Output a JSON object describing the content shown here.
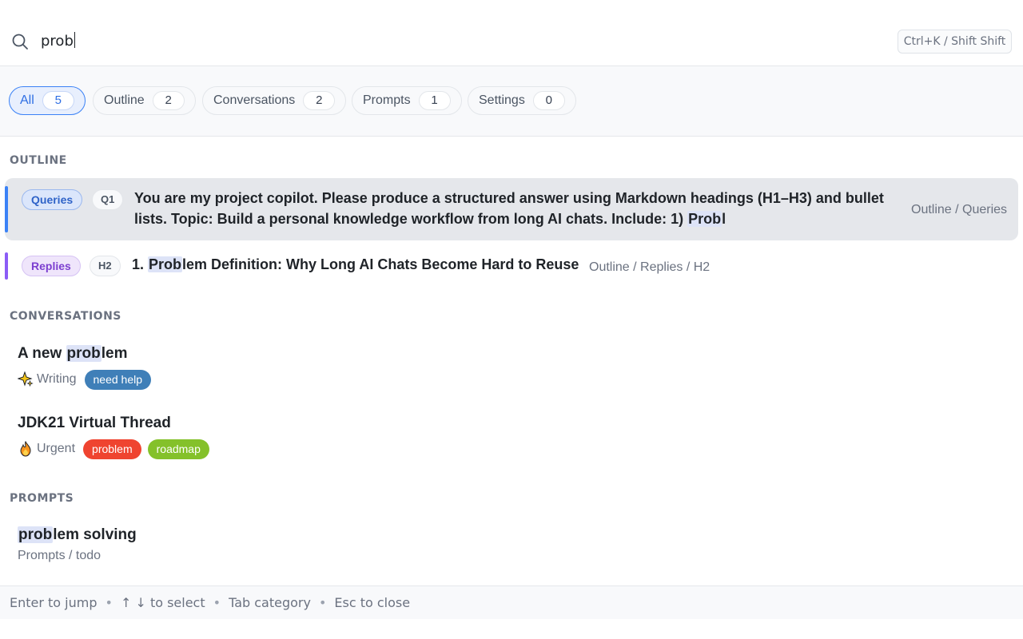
{
  "search": {
    "query": "prob",
    "shortcut": "Ctrl+K / Shift Shift"
  },
  "tabs": [
    {
      "label": "All",
      "count": "5",
      "active": true
    },
    {
      "label": "Outline",
      "count": "2"
    },
    {
      "label": "Conversations",
      "count": "2"
    },
    {
      "label": "Prompts",
      "count": "1"
    },
    {
      "label": "Settings",
      "count": "0"
    }
  ],
  "sections": {
    "outline": "OUTLINE",
    "conversations": "CONVERSATIONS",
    "prompts": "PROMPTS"
  },
  "outline_items": [
    {
      "role": "Queries",
      "level": "Q1",
      "title_before": "You are my project copilot. Please produce a structured answer using Markdown headings (H1–H3) and bullet lists. Topic: Build a personal knowledge workflow from long AI chats. Include: 1) ",
      "title_match": "Prob",
      "title_after": "l",
      "path": "Outline / Queries",
      "selected": true,
      "accent": "#3b82f6"
    },
    {
      "role": "Replies",
      "level": "H2",
      "title_before": "1. ",
      "title_match": "Prob",
      "title_after": "lem Definition: Why Long AI Chats Become Hard to Reuse",
      "path": "Outline / Replies / H2",
      "selected": false,
      "accent": "#8b5cf6"
    }
  ],
  "conversations": [
    {
      "title_before": "A new ",
      "title_match": "prob",
      "title_after": "lem",
      "icon": "sparkle-icon",
      "folder": "Writing",
      "tags": [
        {
          "label": "need help",
          "color": "#3f7fb8"
        }
      ]
    },
    {
      "title_before": "JDK21 Virtual Thread",
      "title_match": "",
      "title_after": "",
      "icon": "fire-icon",
      "folder": "Urgent",
      "tags": [
        {
          "label": "problem",
          "color": "#ef4430"
        },
        {
          "label": "roadmap",
          "color": "#84c12a"
        }
      ]
    }
  ],
  "prompts": [
    {
      "title_before": "",
      "title_match": "prob",
      "title_after": "lem solving",
      "path": "Prompts / todo"
    }
  ],
  "footer": {
    "hints": [
      "Enter to jump",
      "↑ ↓ to select",
      "Tab category",
      "Esc to close"
    ]
  }
}
